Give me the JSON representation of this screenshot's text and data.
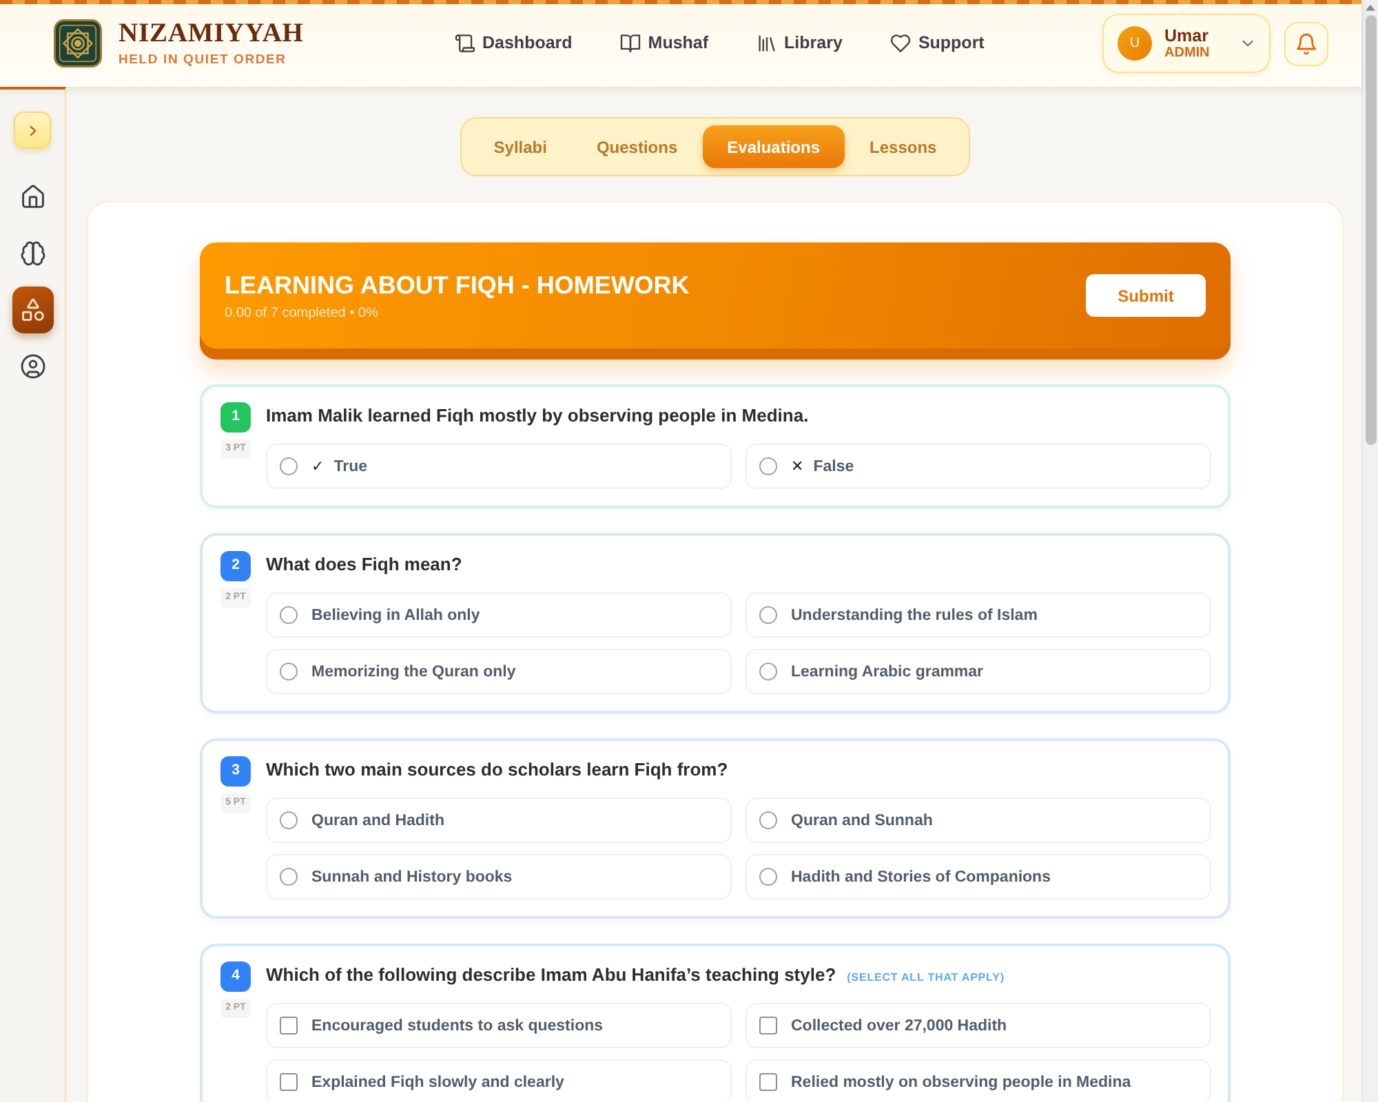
{
  "header": {
    "brand": {
      "name": "NIZAMIYYAH",
      "tagline": "HELD IN QUIET ORDER"
    },
    "nav": [
      {
        "label": "Dashboard"
      },
      {
        "label": "Mushaf"
      },
      {
        "label": "Library"
      },
      {
        "label": "Support"
      }
    ],
    "user": {
      "initial": "U",
      "name": "Umar",
      "role": "ADMIN"
    }
  },
  "sidebar": {
    "items": [
      {
        "selected": false
      },
      {
        "selected": false
      },
      {
        "selected": true
      },
      {
        "selected": false
      }
    ]
  },
  "tabs": [
    {
      "label": "Syllabi",
      "selected": false
    },
    {
      "label": "Questions",
      "selected": false
    },
    {
      "label": "Evaluations",
      "selected": true
    },
    {
      "label": "Lessons",
      "selected": false
    }
  ],
  "assignment": {
    "title": "LEARNING ABOUT FIQH - HOMEWORK",
    "progress": "0.00 of 7 completed • 0%",
    "submit": "Submit"
  },
  "questions": [
    {
      "number": "1",
      "points": "3 PT",
      "text": "Imam Malik learned Fiqh mostly by observing people in Medina.",
      "color": "#22c55e",
      "kind": "single",
      "options": [
        {
          "symbol": "✓",
          "label": "True",
          "selected": false
        },
        {
          "symbol": "✕",
          "label": "False",
          "selected": false
        }
      ]
    },
    {
      "number": "2",
      "points": "2 PT",
      "text": "What does Fiqh mean?",
      "color": "#3182f6",
      "kind": "single",
      "options": [
        {
          "label": "Believing in Allah only",
          "selected": false
        },
        {
          "label": "Understanding the rules of Islam",
          "selected": false
        },
        {
          "label": "Memorizing the Quran only",
          "selected": false
        },
        {
          "label": "Learning Arabic grammar",
          "selected": false
        }
      ]
    },
    {
      "number": "3",
      "points": "5 PT",
      "text": "Which two main sources do scholars learn Fiqh from?",
      "color": "#3182f6",
      "kind": "single",
      "options": [
        {
          "label": "Quran and Hadith",
          "selected": false
        },
        {
          "label": "Quran and Sunnah",
          "selected": false
        },
        {
          "label": "Sunnah and History books",
          "selected": false
        },
        {
          "label": "Hadith and Stories of Companions",
          "selected": false
        }
      ]
    },
    {
      "number": "4",
      "points": "2 PT",
      "text": "Which of the following describe Imam Abu Hanifa’s teaching style?",
      "hint": "(SELECT ALL THAT APPLY)",
      "color": "#3182f6",
      "kind": "multiple",
      "options": [
        {
          "label": "Encouraged students to ask questions",
          "checked": false
        },
        {
          "label": "Collected over 27,000 Hadith",
          "checked": false
        },
        {
          "label": "Explained Fiqh slowly and clearly",
          "checked": false
        },
        {
          "label": "Relied mostly on observing people in Medina",
          "checked": false
        }
      ]
    }
  ]
}
